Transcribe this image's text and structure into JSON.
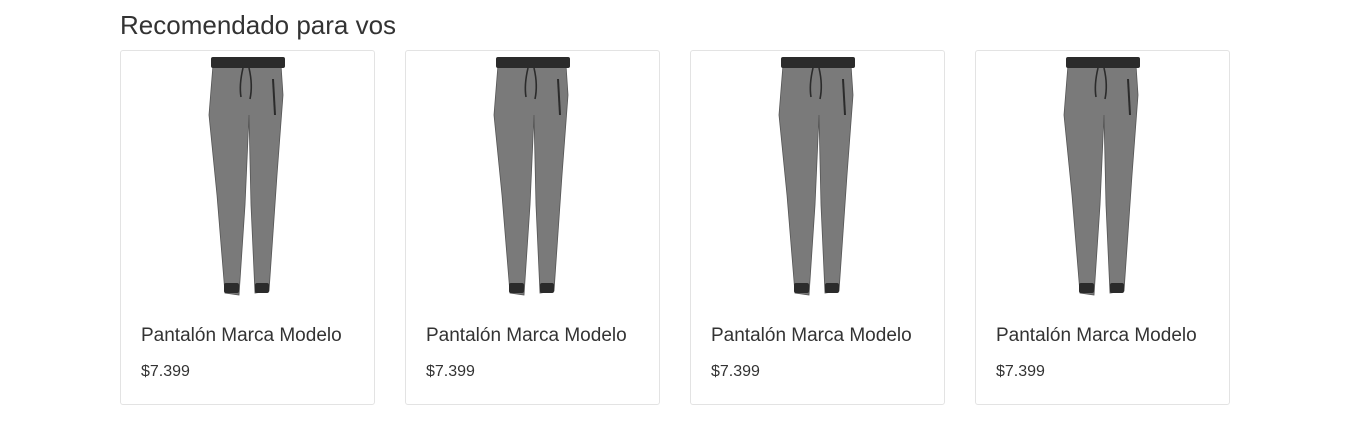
{
  "section": {
    "title": "Recomendado para vos"
  },
  "products": [
    {
      "name": "Pantalón Marca Modelo",
      "price": "$7.399",
      "image_icon": "jogger-pants-image"
    },
    {
      "name": "Pantalón Marca Modelo",
      "price": "$7.399",
      "image_icon": "jogger-pants-image"
    },
    {
      "name": "Pantalón Marca Modelo",
      "price": "$7.399",
      "image_icon": "jogger-pants-image"
    },
    {
      "name": "Pantalón Marca Modelo",
      "price": "$7.399",
      "image_icon": "jogger-pants-image"
    }
  ],
  "colors": {
    "pants_gray": "#7a7a7a",
    "waistband": "#2b2b2b",
    "border": "#e3e3e3",
    "text": "#333333"
  }
}
